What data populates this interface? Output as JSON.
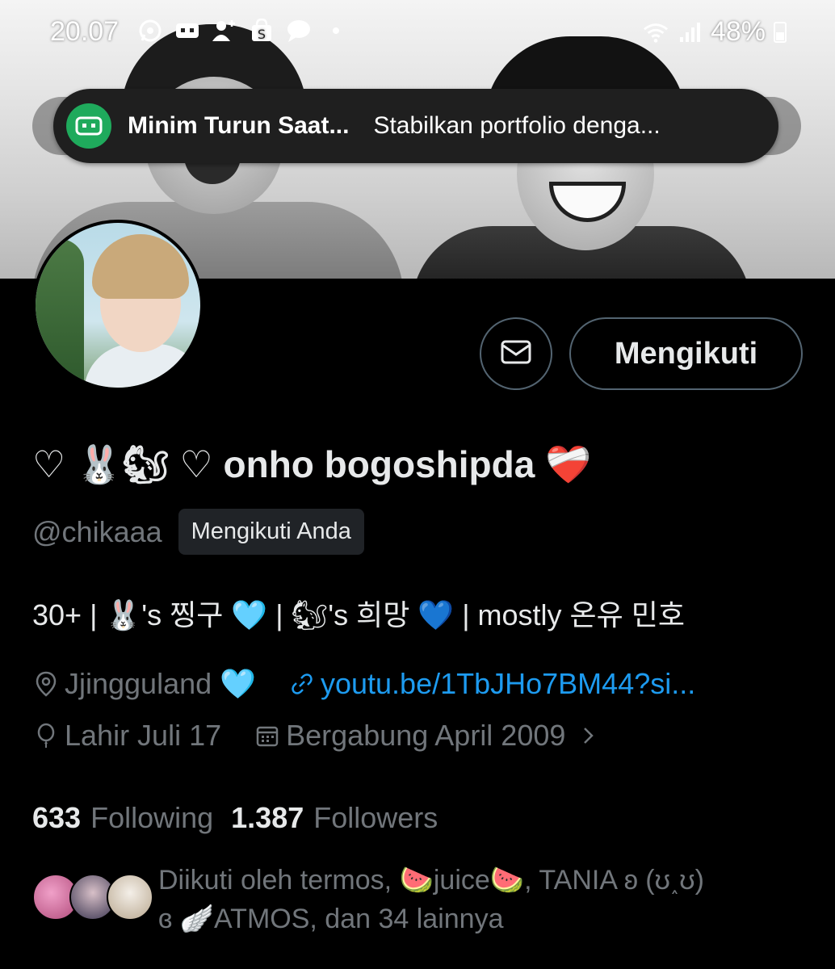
{
  "status_bar": {
    "time": "20.07",
    "battery": "48%",
    "icons_left": [
      "whatsapp-icon",
      "app-icon",
      "add-person-icon",
      "shop-bag-icon",
      "chat-bubble-icon",
      "dot-icon"
    ],
    "icons_right": [
      "wifi-icon",
      "signal-icon",
      "battery-icon"
    ]
  },
  "notification": {
    "title": "Minim Turun Saat...",
    "body": "Stabilkan portfolio denga...",
    "icon_color": "#1faa5c"
  },
  "profile": {
    "display_name": "♡ 🐰🐿 ♡ onho bogoshipda ❤️‍🩹",
    "handle": "@chikaaa",
    "follows_you_label": "Mengikuti Anda",
    "bio": "30+ | 🐰's 찡구 🩵 | 🐿's 희망 💙 | mostly 온유 민호",
    "location": "Jjingguland 🩵",
    "link": "youtu.be/1TbJHo7BM44?si...",
    "birthday": "Lahir Juli 17",
    "joined": "Bergabung April 2009",
    "following_count": "633",
    "following_label": "Following",
    "followers_count": "1.387",
    "followers_label": "Followers",
    "followed_by_line1": "Diikuti oleh termos, 🍉juice🍉, TANIA ʚ (ʊ˰ʊ)",
    "followed_by_line2": "ɞ 🪽ATMOS, dan 34 lainnya"
  },
  "buttons": {
    "message_icon": "envelope-icon",
    "follow_label": "Mengikuti"
  },
  "colors": {
    "background": "#000000",
    "text_primary": "#e7e9ea",
    "text_secondary": "#71767b",
    "link": "#1d9bf0",
    "border": "#536471"
  }
}
